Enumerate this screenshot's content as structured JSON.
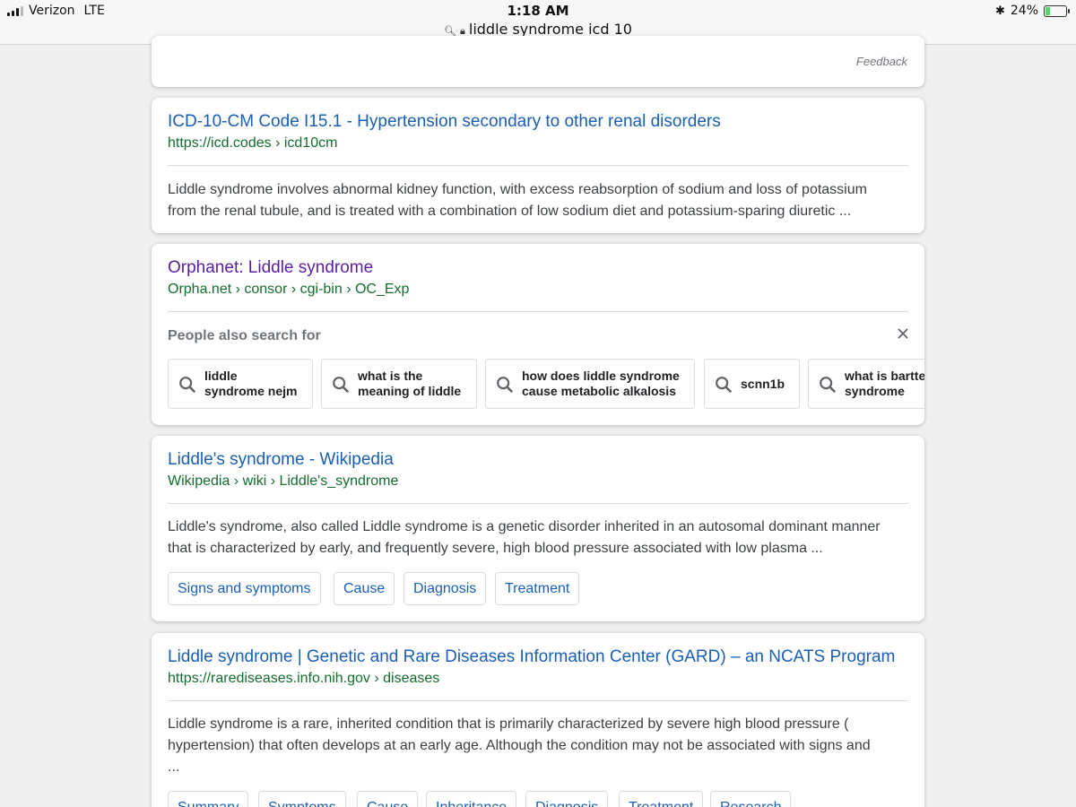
{
  "status": {
    "carrier": "Verizon",
    "network": "LTE",
    "time": "1:18 AM",
    "battery_percent": "24%",
    "battery_level": 0.24,
    "battery_color": "#4cd964",
    "url": "liddle syndrome icd 10",
    "url_icons": [
      "search-icon",
      "lock-icon"
    ]
  },
  "top_card": {
    "feedback": "Feedback"
  },
  "results": [
    {
      "title": "ICD-10-CM Code I15.1 - Hypertension secondary to other renal disorders",
      "cite": "https://icd.codes › icd10cm",
      "snippet_line1": "Liddle syndrome involves abnormal kidney function, with excess reabsorption of sodium and loss of potassium",
      "snippet_line2": "from the renal tubule, and is treated with a combination of low sodium diet and potassium-sparing diuretic ..."
    },
    {
      "title": "Orphanet: Liddle syndrome",
      "cite": "Orpha.net › consor › cgi-bin › OC_Exp",
      "people_also_search_for": "People also search for",
      "chips": [
        "liddle\nsyndrome nejm",
        "what is the\nmeaning of liddle",
        "how does liddle syndrome\ncause metabolic alkalosis",
        "scnn1b",
        "what is bartter\nsyndrome"
      ]
    },
    {
      "title": "Liddle's syndrome - Wikipedia",
      "cite": "Wikipedia › wiki › Liddle's_syndrome",
      "snippet_line1": "Liddle's syndrome, also called Liddle syndrome is a genetic disorder inherited in an autosomal dominant manner",
      "snippet_line2": "that is characterized by early, and frequently severe, high blood pressure associated with low plasma ...",
      "links": [
        "Signs and symptoms",
        "Cause",
        "Diagnosis",
        "Treatment"
      ]
    },
    {
      "title": "Liddle syndrome | Genetic and Rare Diseases Information Center (GARD) – an NCATS Program",
      "cite": "https://rarediseases.info.nih.gov › diseases",
      "snippet_line1": "Liddle syndrome is a rare, inherited condition that is primarily characterized by severe high blood pressure (",
      "snippet_line2": "hypertension) that often develops at an early age. Although the condition may not be associated with signs and",
      "snippet_line3": " ...",
      "links": [
        "Summary",
        "Symptoms",
        "Cause",
        "Inheritance",
        "Diagnosis",
        "Treatment",
        "Research"
      ]
    }
  ],
  "colors": {
    "link_blue": "#1a5fb4",
    "visited_purple": "#5a1ea6",
    "cite_green": "#146c2e"
  }
}
